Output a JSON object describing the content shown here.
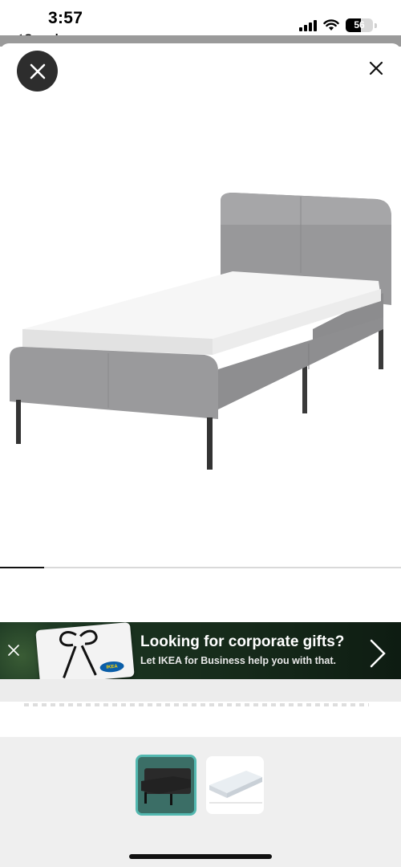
{
  "status_bar": {
    "time": "3:57",
    "back_label": "◀ Search",
    "battery_level": "56"
  },
  "controls": {
    "close_round_icon": "x-icon",
    "close_plain_icon": "x-icon"
  },
  "gallery": {
    "image_subject": "upholstered single bed, grey fabric with white mattress",
    "progress_fraction": 0.11,
    "thumbnails": [
      {
        "subject": "bed-thumbnail",
        "selected": true
      },
      {
        "subject": "mattress-thumbnail",
        "selected": false
      }
    ]
  },
  "ad": {
    "title": "Looking for corporate gifts?",
    "subtitle": "Let IKEA for Business help you with that.",
    "logo_text": "IKEA",
    "close_icon": "x-icon",
    "arrow_icon": "chevron-right-icon"
  },
  "colors": {
    "fabric": "#9a9a9c",
    "ad_bg": "#1e3a24",
    "thumb_border": "#53b8b0"
  }
}
